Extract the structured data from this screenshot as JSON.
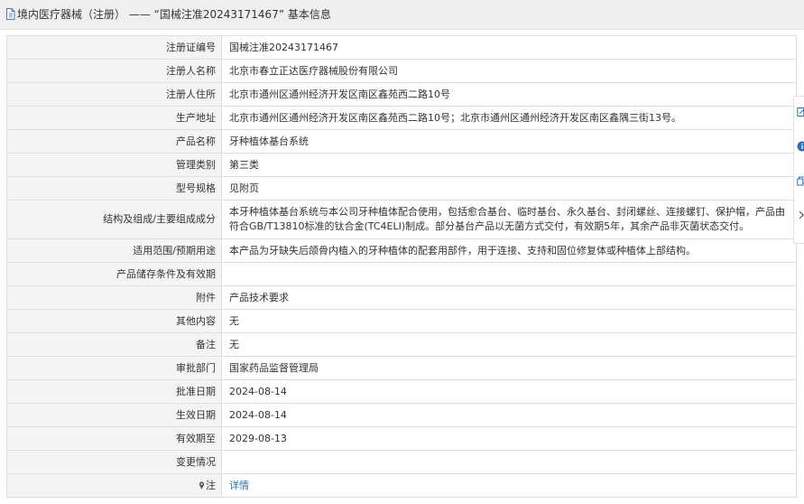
{
  "header": {
    "title": "境内医疗器械（注册） —— “国械注准20243171467” 基本信息"
  },
  "rows": [
    {
      "label": "注册证编号",
      "value": "国械注准20243171467"
    },
    {
      "label": "注册人名称",
      "value": "北京市春立正达医疗器械股份有限公司"
    },
    {
      "label": "注册人住所",
      "value": "北京市通州区通州经济开发区南区鑫苑西二路10号"
    },
    {
      "label": "生产地址",
      "value": "北京市通州区通州经济开发区南区鑫苑西二路10号；北京市通州区通州经济开发区南区鑫隅三街13号。"
    },
    {
      "label": "产品名称",
      "value": "牙种植体基台系统"
    },
    {
      "label": "管理类别",
      "value": "第三类"
    },
    {
      "label": "型号规格",
      "value": "见附页"
    },
    {
      "label": "结构及组成/主要组成成分",
      "value": "本牙种植体基台系统与本公司牙种植体配合使用，包括愈合基台、临时基台、永久基台、封闭螺丝、连接螺钉、保护帽，产品由符合GB/T13810标准的钛合金(TC4ELI)制成。部分基台产品以无菌方式交付，有效期5年，其余产品非灭菌状态交付。"
    },
    {
      "label": "适用范围/预期用途",
      "value": "本产品为牙缺失后颌骨内植入的牙种植体的配套用部件，用于连接、支持和固位修复体或种植体上部结构。"
    },
    {
      "label": "产品储存条件及有效期",
      "value": ""
    },
    {
      "label": "附件",
      "value": "产品技术要求"
    },
    {
      "label": "其他内容",
      "value": "无"
    },
    {
      "label": "备注",
      "value": "无"
    },
    {
      "label": "审批部门",
      "value": "国家药品监督管理局"
    },
    {
      "label": "批准日期",
      "value": "2024-08-14"
    },
    {
      "label": "生效日期",
      "value": "2024-08-14"
    },
    {
      "label": "有效期至",
      "value": "2029-08-13"
    },
    {
      "label": "变更情况",
      "value": ""
    },
    {
      "label": "注",
      "value": "详情"
    }
  ],
  "icons": {
    "header": "document-icon",
    "note": "pin-icon",
    "side": [
      "edit-icon",
      "info-icon",
      "copy-icon",
      "chevron-right-icon"
    ]
  },
  "colors": {
    "link": "#2f6cb5",
    "label_bg": "#f4f4f4",
    "border": "#dedede",
    "header_bg": "#efefef"
  }
}
